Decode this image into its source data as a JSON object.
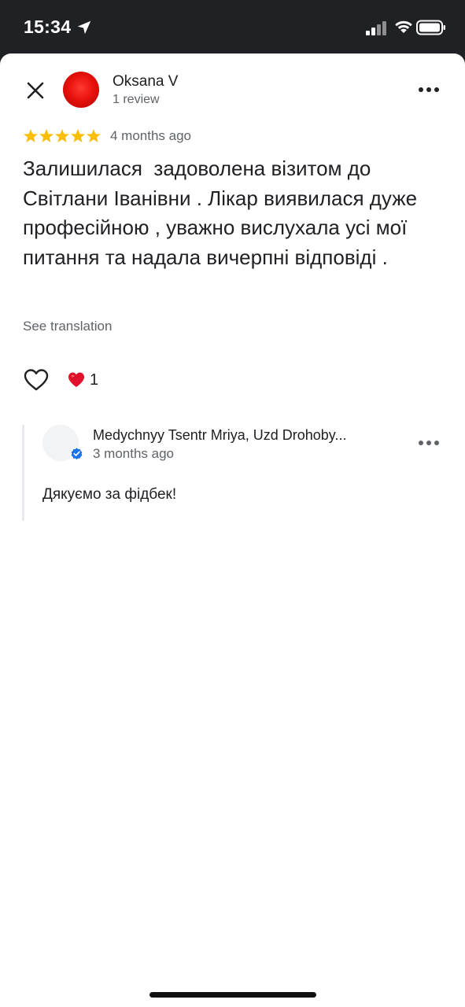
{
  "status_bar": {
    "time": "15:34",
    "icons": [
      "location-arrow-icon",
      "cellular-signal-icon",
      "wifi-icon",
      "battery-icon"
    ]
  },
  "review": {
    "author": "Oksana V",
    "author_meta": "1 review",
    "rating": 5,
    "rating_max": 5,
    "age": "4 months ago",
    "text": "Залишилася  задоволена візитом до Світлани Іванівни . Лікар виявилася дуже професійною , уважно вислухала усі мої питання та надала вичерпні відповіді .",
    "see_translation": "See translation",
    "reaction_count": "1"
  },
  "owner_reply": {
    "name": "Medychnyy Tsentr Mriya, Uzd Drohoby...",
    "age": "3 months ago",
    "text": "Дякуємо за фідбек!"
  },
  "colors": {
    "star": "#fbbc04",
    "avatar": "#e8130d",
    "heart": "#e0112b",
    "verified": "#1a73e8",
    "secondary_text": "#5f6368"
  }
}
